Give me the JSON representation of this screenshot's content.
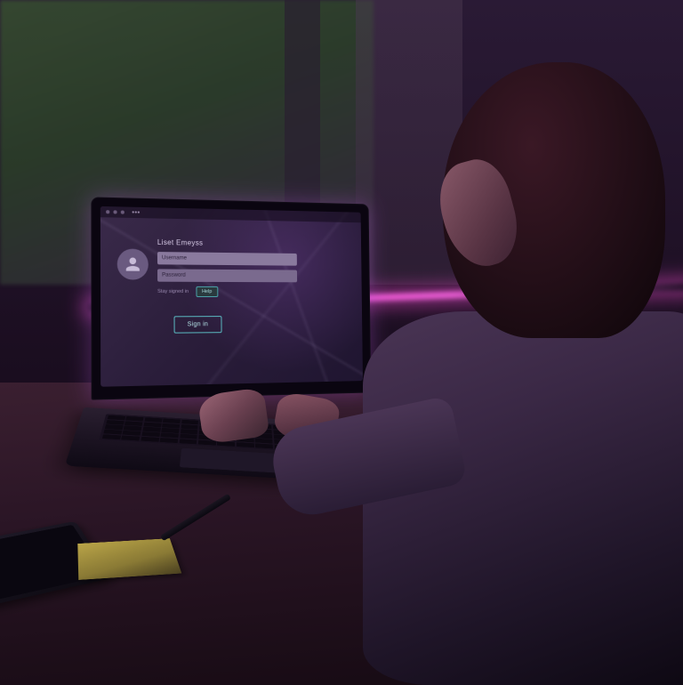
{
  "screen": {
    "title": "Liset Emeyss",
    "username_placeholder": "Username",
    "password_placeholder": "Password",
    "helper": "Stay signed in",
    "small_button": "Help",
    "action_button": "Sign in",
    "avatar_icon": "user-icon"
  },
  "colors": {
    "neon": "#ff50dc",
    "accent": "#5ab8c0",
    "screen_bg": "#2a1d3a"
  }
}
